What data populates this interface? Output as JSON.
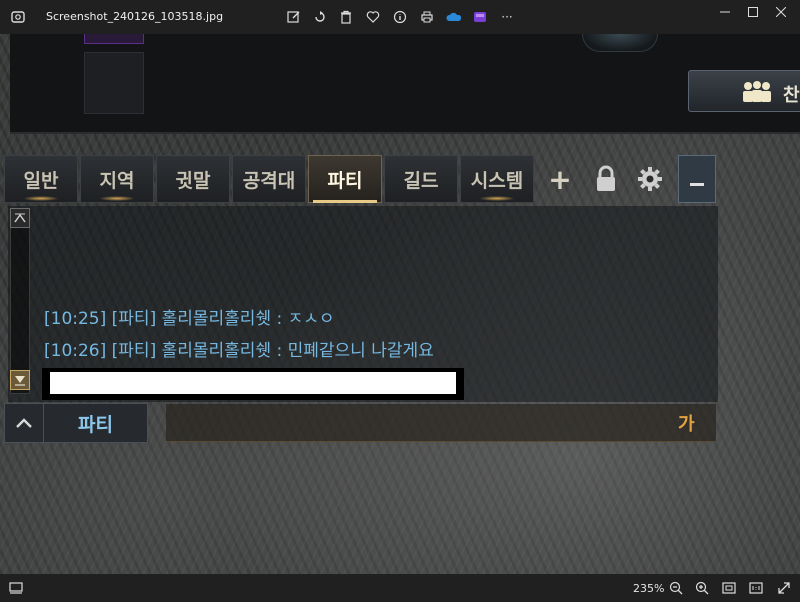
{
  "window": {
    "filename": "Screenshot_240126_103518.jpg"
  },
  "toolbar": {
    "icons": [
      "edit-icon",
      "rotate-icon",
      "delete-icon",
      "favorite-icon",
      "info-icon",
      "print-icon",
      "onedrive-icon",
      "clipchamp-icon",
      "more-icon"
    ],
    "more_label": "···"
  },
  "game": {
    "tabs": [
      "일반",
      "지역",
      "귓말",
      "공격대",
      "파티",
      "길드",
      "시스템"
    ],
    "active_tab": "파티",
    "add_tab_label": "+",
    "party_mgmt_label": "찬",
    "messages": [
      "[10:25] [파티] 홀리몰리홀리쉣 : ㅈㅅㅇ",
      "[10:26] [파티] 홀리몰리홀리쉣 : 민폐같으니 나갈게요"
    ],
    "channel_label": "파티",
    "ime_indicator": "가"
  },
  "statusbar": {
    "zoom": "235%"
  },
  "colors": {
    "message_text": "#76b8e0",
    "ime": "#e3a23f",
    "active_tab_underline": "#e7c988"
  }
}
